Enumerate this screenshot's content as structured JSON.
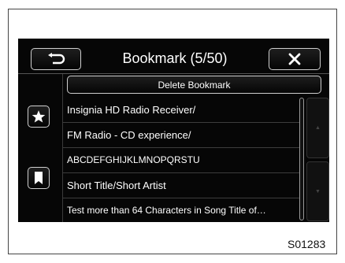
{
  "header": {
    "title": "Bookmark (5/50)",
    "back_icon": "back-arrow-icon",
    "close_icon": "close-icon"
  },
  "actions": {
    "delete_label": "Delete Bookmark"
  },
  "side": {
    "star_icon": "star-icon",
    "bookmark_icon": "bookmark-icon"
  },
  "list": {
    "items": [
      {
        "label": "Insignia HD Radio Receiver/"
      },
      {
        "label": "FM Radio - CD experience/"
      },
      {
        "label": "ABCDEFGHIJKLMNOPQRSTU"
      },
      {
        "label": "Short Title/Short Artist"
      },
      {
        "label": "Test more than 64 Characters in Song Title of…"
      }
    ]
  },
  "figure_code": "S01283"
}
